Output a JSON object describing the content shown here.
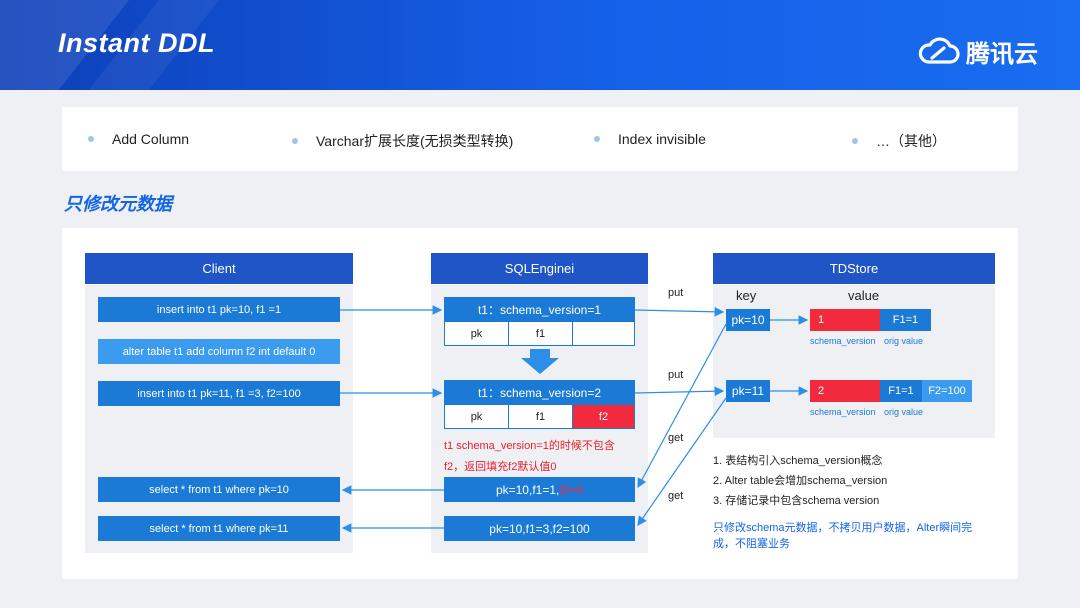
{
  "header": {
    "title": "Instant DDL",
    "brand": "腾讯云"
  },
  "features": [
    "Add Column",
    "Varchar扩展长度(无损类型转换)",
    "Index invisible",
    "…（其他）"
  ],
  "section_title": "只修改元数据",
  "client": {
    "title": "Client",
    "rows": [
      "insert into t1 pk=10, f1 =1",
      "alter table t1 add column f2 int default 0",
      "insert into t1 pk=11, f1 =3, f2=100",
      "select * from t1 where pk=10",
      "select * from t1 where pk=11"
    ]
  },
  "sqlengine": {
    "title": "SQLEnginei",
    "schema1": "t1：schema_version=1",
    "schema2": "t1：schema_version=2",
    "cols1": [
      "pk",
      "f1",
      ""
    ],
    "cols2": [
      "pk",
      "f1",
      "f2"
    ],
    "red_note_1": "t1 schema_version=1的时候不包含",
    "red_note_2": "f2，返回填充f2默认值0",
    "result1_prefix": "pk=10,f1=1,",
    "result1_red": "f2=0",
    "result2": "pk=10,f1=3,f2=100"
  },
  "tdstore": {
    "title": "TDStore",
    "key_label": "key",
    "value_label": "value",
    "row1": {
      "key": "pk=10",
      "version": "1",
      "f1": "F1=1",
      "f2": ""
    },
    "row2": {
      "key": "pk=11",
      "version": "2",
      "f1": "F1=1",
      "f2": "F2=100"
    },
    "schema_version_label": "schema_version",
    "orig_value_label": "orig value",
    "notes": [
      "1.  表结构引入schema_version概念",
      "2.  Alter table会增加schema_version",
      "3.  存储记录中包含schema version"
    ],
    "summary": [
      "只修改schema元数据，不拷贝用户数据，Alter瞬间完",
      "成，不阻塞业务"
    ]
  },
  "arrow_labels": {
    "put1": "put",
    "put2": "put",
    "get1": "get",
    "get2": "get"
  },
  "colors": {
    "header_blue": "#1560e8",
    "box_blue": "#1b7ad6",
    "head_blue": "#1f55c6",
    "red": "#f22a3e",
    "title_blue": "#1466e4"
  }
}
